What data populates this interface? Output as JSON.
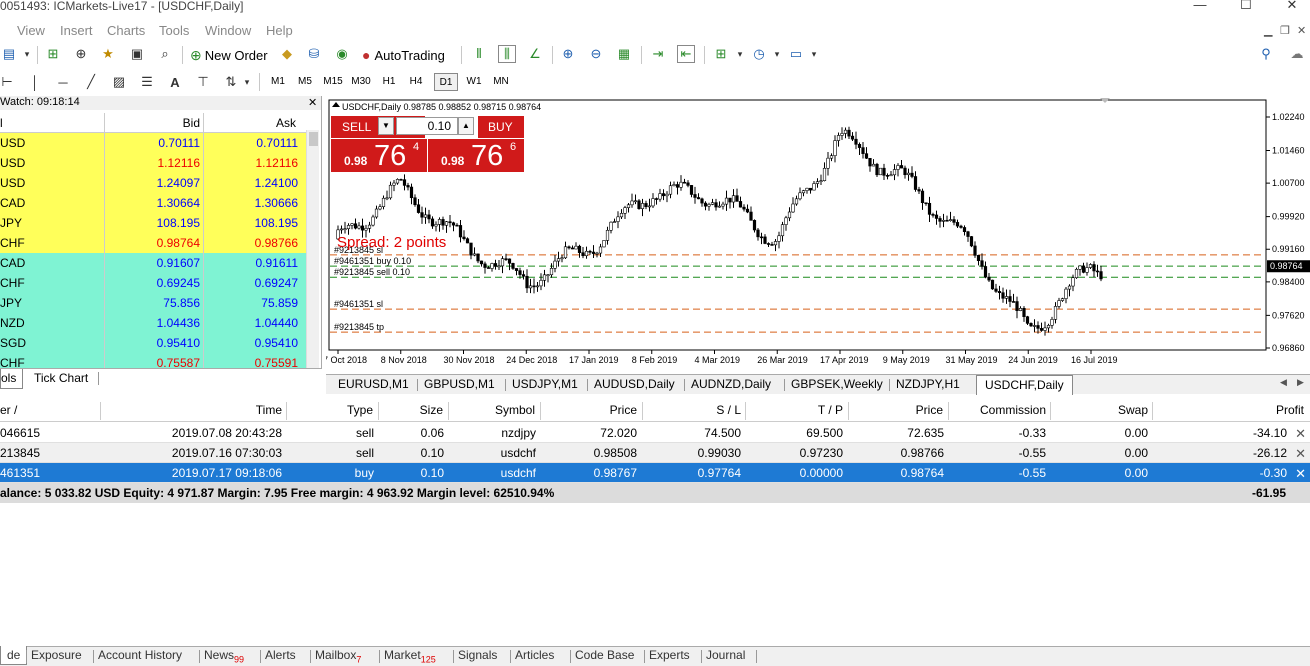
{
  "window": {
    "title": "0051493: ICMarkets-Live17 - [USDCHF,Daily]",
    "controls": [
      "—",
      "☐",
      "✕"
    ]
  },
  "menu": [
    "View",
    "Insert",
    "Charts",
    "Tools",
    "Window",
    "Help"
  ],
  "toolbar": {
    "new_order": "New Order",
    "autotrading": "AutoTrading",
    "timeframes": [
      "M1",
      "M5",
      "M15",
      "M30",
      "H1",
      "H4",
      "D1",
      "W1",
      "MN"
    ],
    "active_timeframe": "D1"
  },
  "market_watch": {
    "header": "Watch: 09:18:14",
    "columns": [
      "l",
      "Bid",
      "Ask"
    ],
    "rows": [
      {
        "symbol": "USD",
        "bid": "0.70111",
        "ask": "0.70111",
        "bg": "#ffff5a",
        "color": "#00f"
      },
      {
        "symbol": "USD",
        "bid": "1.12116",
        "ask": "1.12116",
        "bg": "#ffff5a",
        "color": "#e00"
      },
      {
        "symbol": "USD",
        "bid": "1.24097",
        "ask": "1.24100",
        "bg": "#ffff5a",
        "color": "#00f"
      },
      {
        "symbol": "CAD",
        "bid": "1.30664",
        "ask": "1.30666",
        "bg": "#ffff5a",
        "color": "#00f"
      },
      {
        "symbol": "JPY",
        "bid": "108.195",
        "ask": "108.195",
        "bg": "#ffff5a",
        "color": "#00f"
      },
      {
        "symbol": "CHF",
        "bid": "0.98764",
        "ask": "0.98766",
        "bg": "#ffff5a",
        "color": "#e00"
      },
      {
        "symbol": "CAD",
        "bid": "0.91607",
        "ask": "0.91611",
        "bg": "#7ff3d3",
        "color": "#00f"
      },
      {
        "symbol": "CHF",
        "bid": "0.69245",
        "ask": "0.69247",
        "bg": "#7ff3d3",
        "color": "#00f"
      },
      {
        "symbol": "JPY",
        "bid": "75.856",
        "ask": "75.859",
        "bg": "#7ff3d3",
        "color": "#00f"
      },
      {
        "symbol": "NZD",
        "bid": "1.04436",
        "ask": "1.04440",
        "bg": "#7ff3d3",
        "color": "#00f"
      },
      {
        "symbol": "SGD",
        "bid": "0.95410",
        "ask": "0.95410",
        "bg": "#7ff3d3",
        "color": "#00f"
      },
      {
        "symbol": "CHF",
        "bid": "0.75587",
        "ask": "0.75591",
        "bg": "#7ff3d3",
        "color": "#e00"
      }
    ],
    "tabs": [
      "ols",
      "Tick Chart"
    ]
  },
  "chart": {
    "info": "USDCHF,Daily  0.98785 0.98852 0.98715 0.98764",
    "sell_label": "SELL",
    "buy_label": "BUY",
    "lot": "0.10",
    "sell_price_small": "0.98",
    "sell_price_big": "76",
    "sell_price_sup": "4",
    "buy_price_small": "0.98",
    "buy_price_big": "76",
    "buy_price_sup": "6",
    "spread_label": "Spread: 2 points",
    "order_labels": [
      "#9213845 sl",
      "#9461351 buy 0.10",
      "#9213845 sell 0.10",
      "#9461351 sl",
      "#9213845 tp"
    ],
    "current_price": "0.98764"
  },
  "chart_data": {
    "type": "candlestick",
    "title": "USDCHF,Daily",
    "y_ticks": [
      "1.02240",
      "1.01460",
      "1.00700",
      "0.99920",
      "0.99160",
      "0.98400",
      "0.97620",
      "0.96860"
    ],
    "x_ticks": [
      "17 Oct 2018",
      "8 Nov 2018",
      "30 Nov 2018",
      "24 Dec 2018",
      "17 Jan 2019",
      "8 Feb 2019",
      "4 Mar 2019",
      "26 Mar 2019",
      "17 Apr 2019",
      "9 May 2019",
      "31 May 2019",
      "24 Jun 2019",
      "16 Jul 2019"
    ],
    "ylim": [
      0.9686,
      1.0224
    ],
    "trend": [
      {
        "date": "17 Oct 2018",
        "price": 0.994
      },
      {
        "date": "8 Nov 2018",
        "price": 1.006
      },
      {
        "date": "30 Nov 2018",
        "price": 0.993
      },
      {
        "date": "24 Dec 2018",
        "price": 0.984
      },
      {
        "date": "17 Jan 2019",
        "price": 0.992
      },
      {
        "date": "8 Feb 2019",
        "price": 1.005
      },
      {
        "date": "4 Mar 2019",
        "price": 1.004
      },
      {
        "date": "26 Mar 2019",
        "price": 0.994
      },
      {
        "date": "17 Apr 2019",
        "price": 1.018
      },
      {
        "date": "9 May 2019",
        "price": 1.008
      },
      {
        "date": "31 May 2019",
        "price": 0.994
      },
      {
        "date": "24 Jun 2019",
        "price": 0.972
      },
      {
        "date": "16 Jul 2019",
        "price": 0.9876
      }
    ],
    "levels": [
      {
        "label": "#9213845 sl",
        "price": 0.9903
      },
      {
        "label": "#9461351 buy 0.10",
        "price": 0.98767
      },
      {
        "label": "#9213845 sell 0.10",
        "price": 0.98508
      },
      {
        "label": "#9461351 sl",
        "price": 0.97764
      },
      {
        "label": "#9213845 tp",
        "price": 0.9723
      }
    ]
  },
  "chart_tabs": [
    "EURUSD,M1",
    "GBPUSD,M1",
    "USDJPY,M1",
    "AUDUSD,Daily",
    "AUDNZD,Daily",
    "GBPSEK,Weekly",
    "NZDJPY,H1",
    "USDCHF,Daily"
  ],
  "terminal": {
    "columns": [
      "er  /",
      "Time",
      "Type",
      "Size",
      "Symbol",
      "Price",
      "S / L",
      "T / P",
      "Price",
      "Commission",
      "Swap",
      "Profit"
    ],
    "rows": [
      {
        "order": "046615",
        "time": "2019.07.08 20:43:28",
        "type": "sell",
        "size": "0.06",
        "symbol": "nzdjpy",
        "price": "72.020",
        "sl": "74.500",
        "tp": "69.500",
        "cur": "72.635",
        "comm": "-0.33",
        "swap": "0.00",
        "profit": "-34.10"
      },
      {
        "order": "213845",
        "time": "2019.07.16 07:30:03",
        "type": "sell",
        "size": "0.10",
        "symbol": "usdchf",
        "price": "0.98508",
        "sl": "0.99030",
        "tp": "0.97230",
        "cur": "0.98766",
        "comm": "-0.55",
        "swap": "0.00",
        "profit": "-26.12"
      },
      {
        "order": "461351",
        "time": "2019.07.17 09:18:06",
        "type": "buy",
        "size": "0.10",
        "symbol": "usdchf",
        "price": "0.98767",
        "sl": "0.97764",
        "tp": "0.00000",
        "cur": "0.98764",
        "comm": "-0.55",
        "swap": "0.00",
        "profit": "-0.30"
      }
    ],
    "balance_text": "alance: 5 033.82 USD  Equity: 4 971.87  Margin: 7.95  Free margin: 4 963.92  Margin level: 62510.94%",
    "total_profit": "-61.95"
  },
  "bottom_tabs": [
    {
      "label": "de",
      "badge": ""
    },
    {
      "label": "Exposure",
      "badge": ""
    },
    {
      "label": "Account History",
      "badge": ""
    },
    {
      "label": "News",
      "badge": "99"
    },
    {
      "label": "Alerts",
      "badge": ""
    },
    {
      "label": "Mailbox",
      "badge": "7"
    },
    {
      "label": "Market",
      "badge": "125"
    },
    {
      "label": "Signals",
      "badge": ""
    },
    {
      "label": "Articles",
      "badge": ""
    },
    {
      "label": "Code Base",
      "badge": ""
    },
    {
      "label": "Experts",
      "badge": ""
    },
    {
      "label": "Journal",
      "badge": ""
    }
  ],
  "colors": {
    "selected_row": "#1e7ad4",
    "sell_buy": "#d01a1a",
    "level_orange": "#d8601a",
    "level_green": "#1c8a1c"
  }
}
